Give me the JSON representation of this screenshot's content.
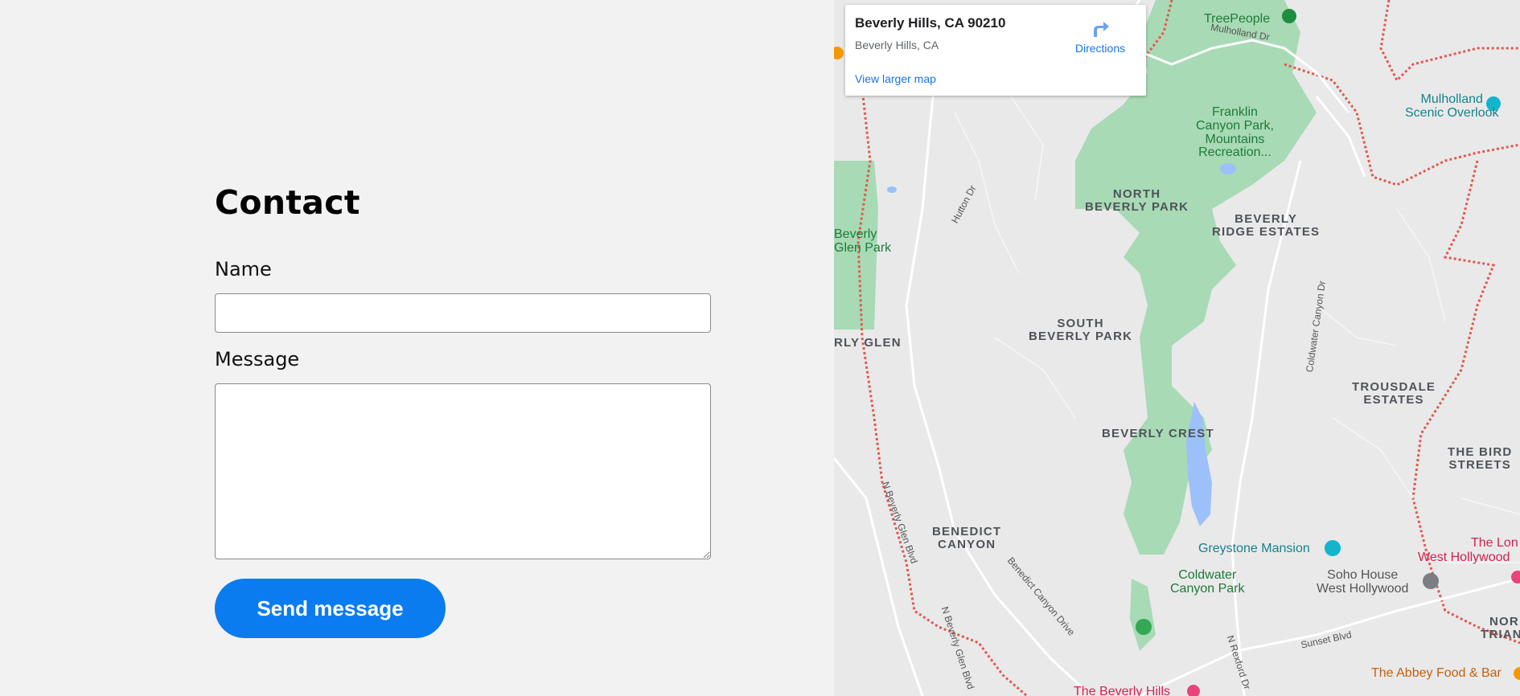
{
  "form": {
    "title": "Contact",
    "name_label": "Name",
    "name_value": "",
    "message_label": "Message",
    "message_value": "",
    "send_label": "Send message"
  },
  "map": {
    "card": {
      "title": "Beverly Hills, CA 90210",
      "subtitle": "Beverly Hills, CA",
      "larger_map_link": "View larger map",
      "directions_label": "Directions"
    },
    "labels": {
      "treepeople": "TreePeople",
      "mulholland_dr": "Mulholland Dr",
      "franklin": "Franklin\nCanyon Park,\nMountains\nRecreation...",
      "mulholland_overlook": "Mulholland\nScenic Overlook",
      "north_bp": "NORTH\nBEVERLY PARK",
      "beverly_ridge": "BEVERLY\nRIDGE ESTATES",
      "beverly_glen_park": "Beverly\nGlen Park",
      "rly_glen": "RLY GLEN",
      "south_bp": "SOUTH\nBEVERLY PARK",
      "trousdale": "TROUSDALE\nESTATES",
      "beverly_crest": "BEVERLY CREST",
      "bird_streets": "THE BIRD\nSTREETS",
      "benedict_canyon": "BENEDICT\nCANYON",
      "greystone": "Greystone Mansion",
      "the_lon": "The Lon",
      "west_hollywood": "West Hollywood",
      "soho_house": "Soho House\nWest Hollywood",
      "coldwater_park": "Coldwater\nCanyon Park",
      "nor": "NOR",
      "trian": "TRIAN",
      "sunset_blvd": "Sunset Blvd",
      "abbey": "The Abbey Food & Bar",
      "beverly_hills_hotel": "The Beverly Hills",
      "hutton_dr": "Hutton Dr",
      "coldwater_canyon_dr": "Coldwater Canyon Dr",
      "n_beverly_glen_1": "N Beverly Glen Blvd",
      "n_beverly_glen_2": "N Beverly Glen Blvd",
      "benedict_canyon_dr": "Benedict Canyon Drive",
      "n_rexford": "N Rexford Dr"
    },
    "colors": {
      "park_green": "#a8dab5",
      "water_blue": "#9cc0f9",
      "boundary_red": "#e05a4e",
      "accent_blue": "#1a73e8",
      "send_button": "#0a7cf0"
    }
  }
}
